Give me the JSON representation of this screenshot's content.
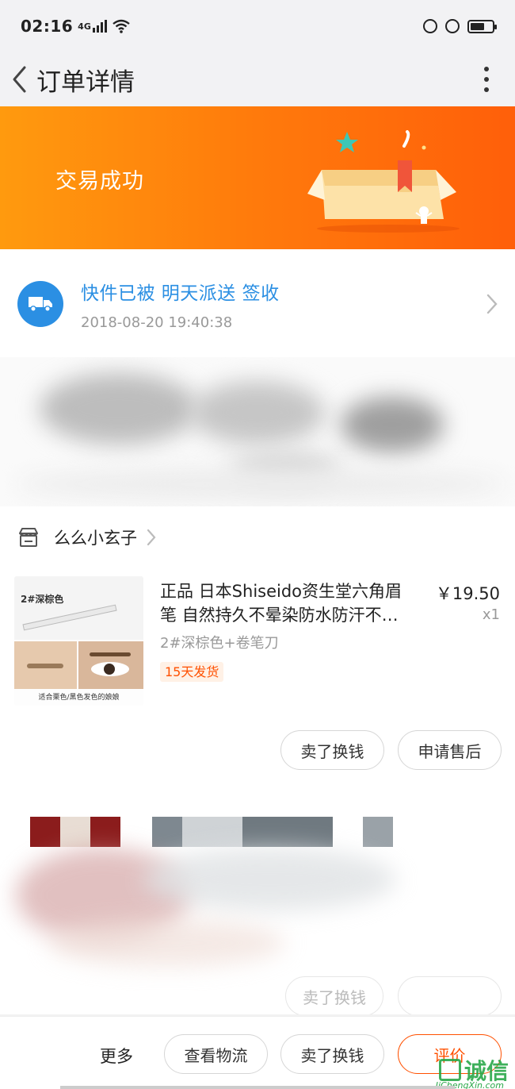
{
  "status_bar": {
    "time": "02:16",
    "network": "4G"
  },
  "nav": {
    "title": "订单详情"
  },
  "banner": {
    "text": "交易成功"
  },
  "logistics": {
    "status": "快件已被 明天派送 签收",
    "time": "2018-08-20 19:40:38"
  },
  "shop": {
    "name": "么么小玄子"
  },
  "product": {
    "title_line1": "正品 日本Shiseido资生堂六角眉",
    "title_line2": "笔 自然持久不晕染防水防汗不…",
    "price": "￥19.50",
    "qty": "x1",
    "sku": "2#深棕色+卷笔刀",
    "ship_tag": "15天发货",
    "image_label": "2#深棕色",
    "image_caption": "适合栗色/黑色发色的娘娘"
  },
  "item_actions": {
    "sell": "卖了换钱",
    "after_sale": "申请售后"
  },
  "bottom_bar": {
    "more": "更多",
    "logistics": "查看物流",
    "sell": "卖了换钱",
    "review": "评价"
  },
  "watermark": {
    "text": "诚信",
    "sub": "JiChengXin.com"
  },
  "colors": {
    "accent": "#ff5000",
    "link": "#2b8fe3",
    "banner_start": "#ff9a0e",
    "banner_end": "#ff5f0a"
  }
}
